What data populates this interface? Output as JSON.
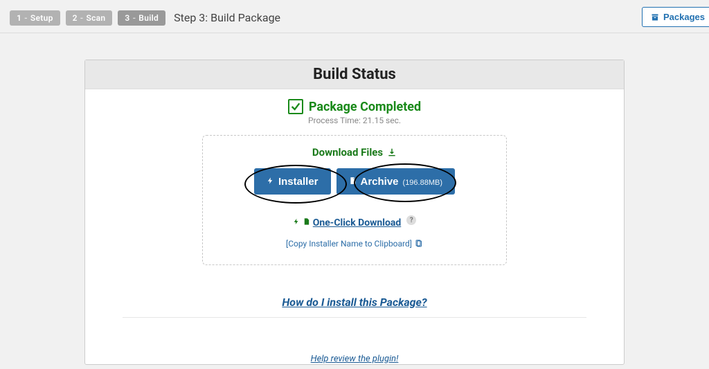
{
  "wizard": {
    "steps": [
      {
        "num": "1",
        "label": "Setup"
      },
      {
        "num": "2",
        "label": "Scan"
      },
      {
        "num": "3",
        "label": "Build"
      }
    ],
    "title": "Step 3: Build Package"
  },
  "header_button": {
    "label": "Packages"
  },
  "panel": {
    "title": "Build Status",
    "completed": "Package Completed",
    "process_time": "Process Time: 21.15 sec.",
    "download_heading": "Download Files",
    "installer_label": "Installer",
    "archive_label": "Archive",
    "archive_size": "(196.88MB)",
    "one_click": "One-Click Download",
    "copy_installer": "[Copy Installer Name to Clipboard]",
    "how_install": "How do I install this Package?",
    "review": "Help review the plugin!"
  }
}
